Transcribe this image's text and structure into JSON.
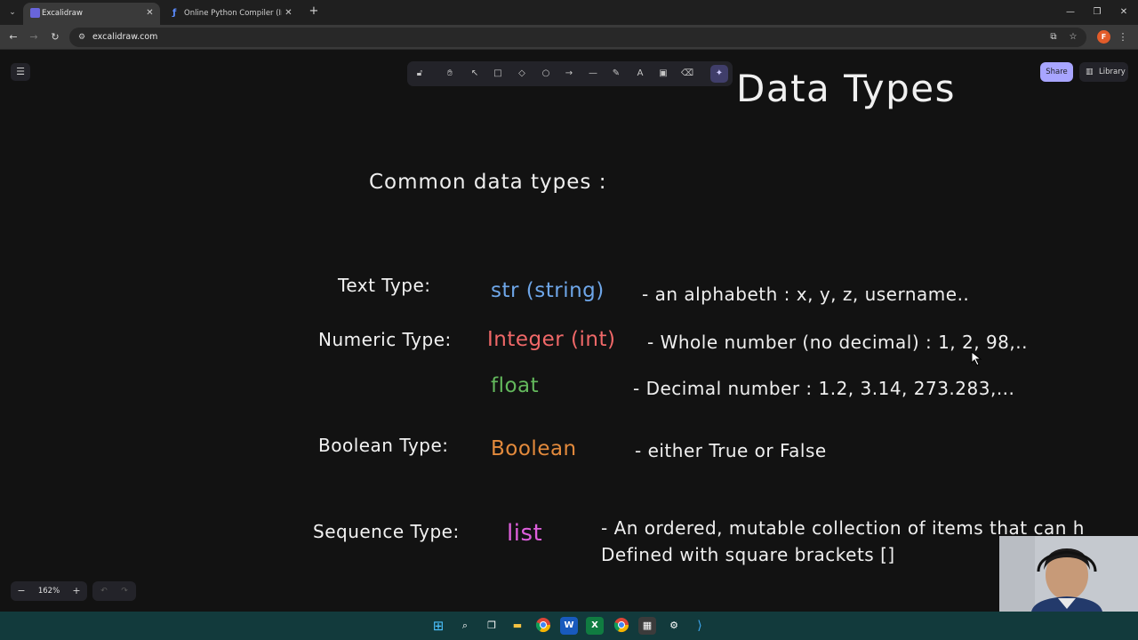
{
  "browser": {
    "tabs": [
      {
        "title": "Excalidraw",
        "active": true
      },
      {
        "title": "Online Python Compiler (Interp",
        "active": false
      }
    ],
    "url": "excalidraw.com",
    "profile_initial": "F"
  },
  "excalidraw": {
    "toolbar_tools": [
      "lock",
      "hand",
      "selection",
      "rectangle",
      "diamond",
      "ellipse",
      "arrow",
      "line",
      "draw",
      "text",
      "image",
      "eraser",
      "ai-tools"
    ],
    "share_label": "Share",
    "library_label": "Library",
    "zoom": "162%"
  },
  "drawing": {
    "title": "Data Types",
    "subtitle": "Common data types :",
    "rows": [
      {
        "label": "Text Type:",
        "type": "str (string)",
        "type_color": "#6ea6e8",
        "desc": "- an alphabeth : x, y, z, username.."
      },
      {
        "label": "Numeric Type:",
        "type": "Integer (int)",
        "type_color": "#f06868",
        "desc": "- Whole number (no decimal) : 1, 2, 98,.."
      },
      {
        "label": "",
        "type": "float",
        "type_color": "#63b85c",
        "desc": "- Decimal number : 1.2, 3.14, 273.283,..."
      },
      {
        "label": "Boolean Type:",
        "type": "Boolean",
        "type_color": "#e38a3c",
        "desc": "- either True or False"
      },
      {
        "label": "Sequence Type:",
        "type": "list",
        "type_color": "#de5fdc",
        "desc": "- An ordered, mutable collection of items that can h",
        "desc2": "Defined with square brackets []"
      }
    ]
  },
  "taskbar": {
    "icons": [
      "windows-start",
      "search",
      "task-view",
      "file-explorer",
      "chrome",
      "word",
      "excel",
      "chrome-2",
      "calculator",
      "settings",
      "vscode"
    ]
  }
}
